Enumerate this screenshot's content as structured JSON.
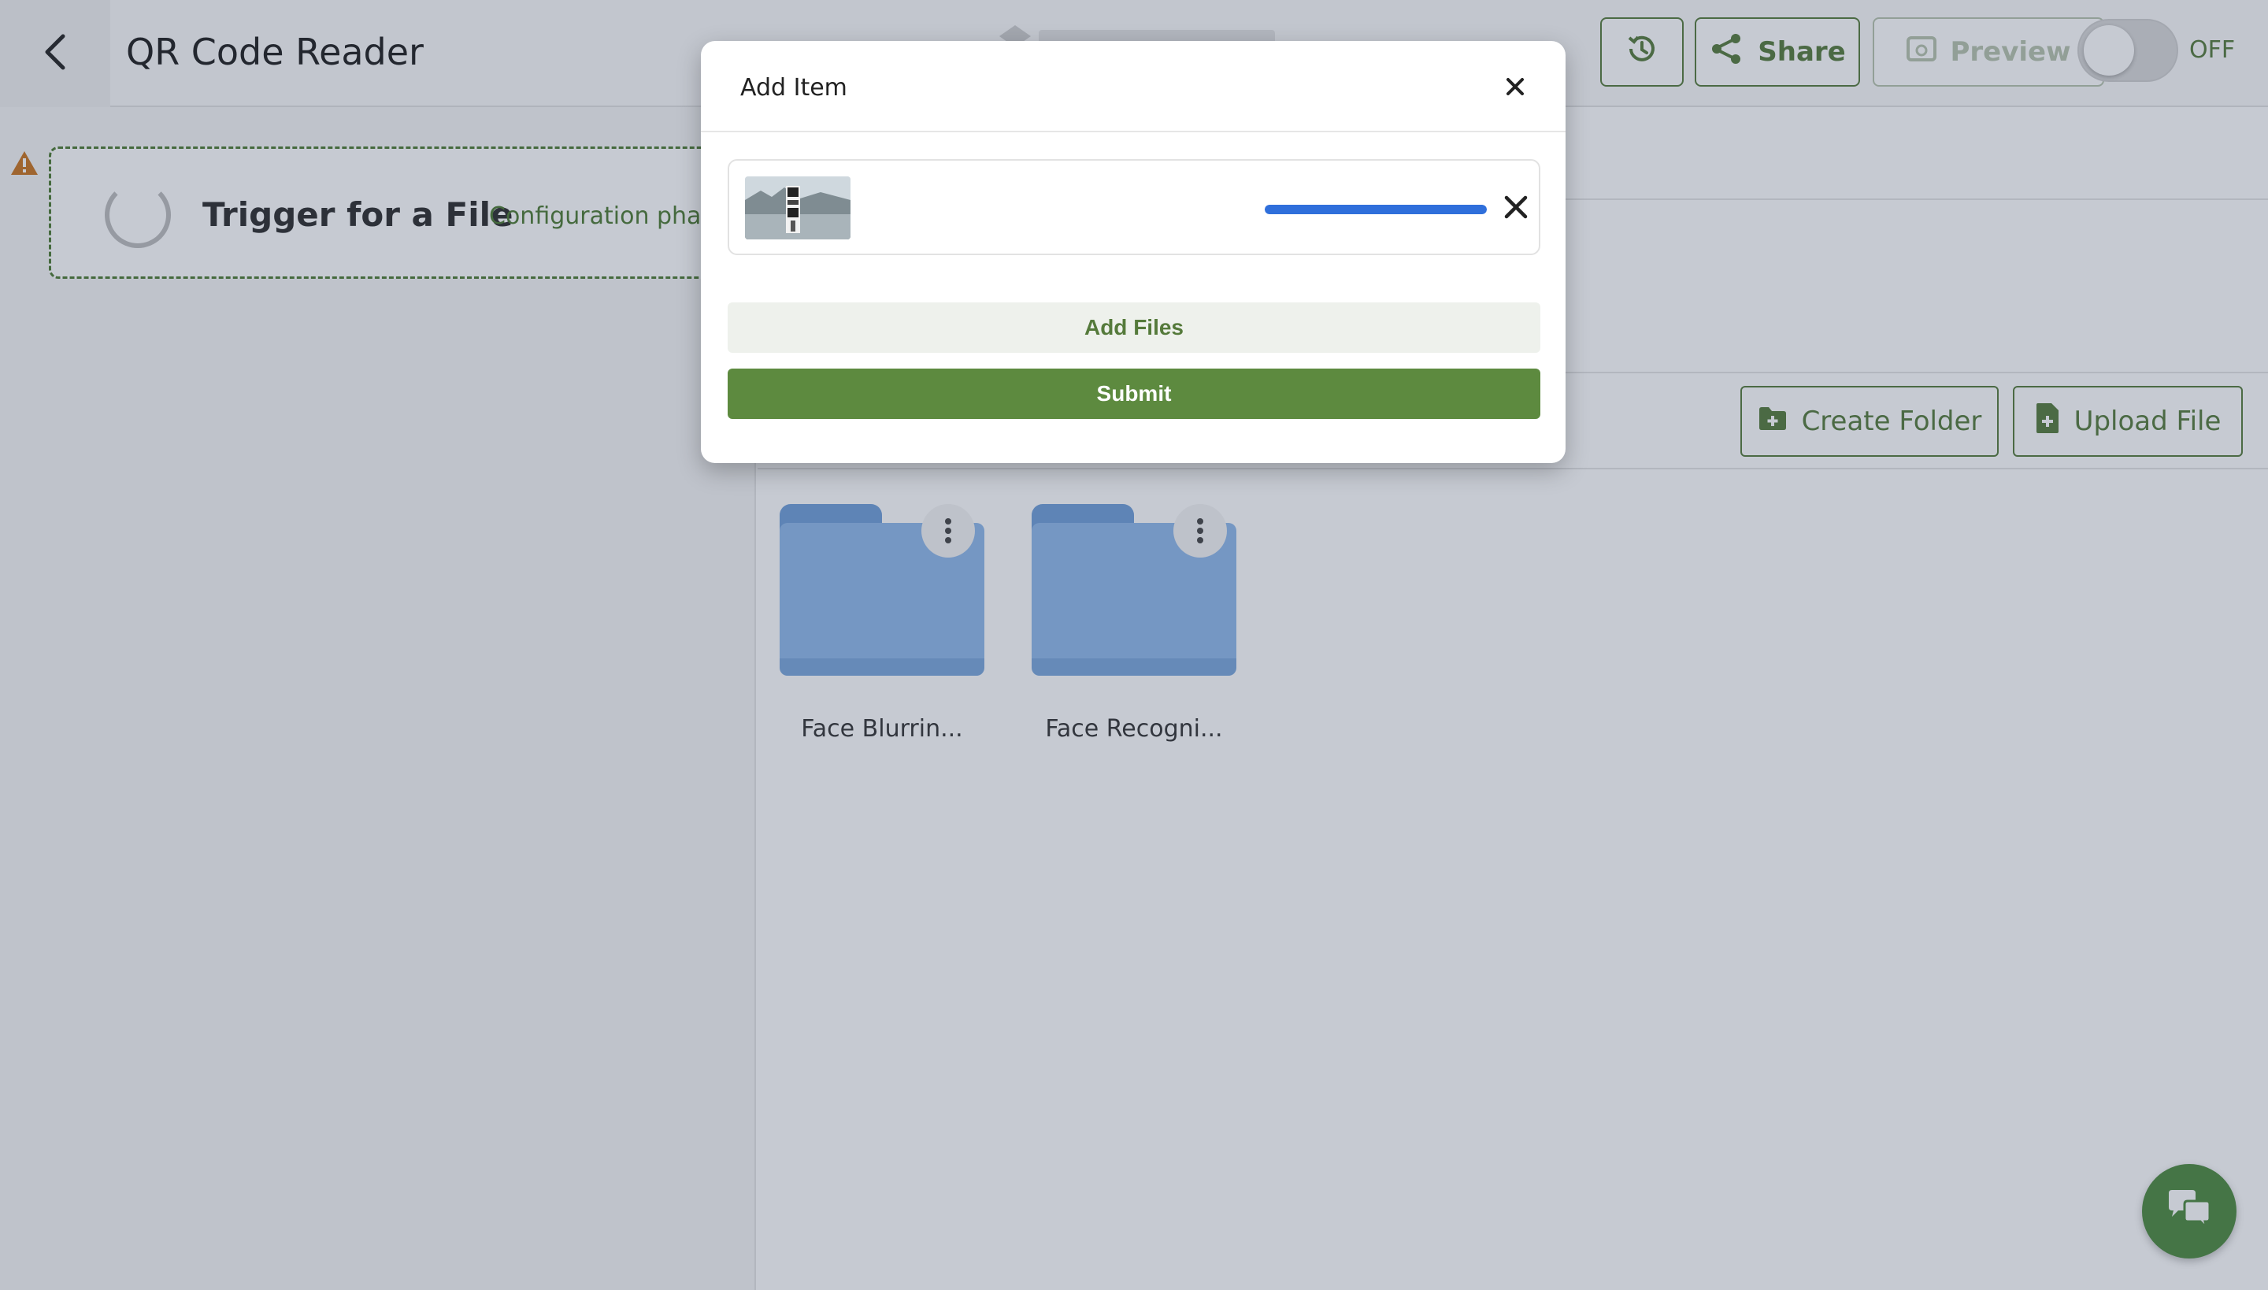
{
  "header": {
    "title": "QR Code Reader",
    "share_label": "Share",
    "preview_label": "Preview",
    "toggle_state": "OFF",
    "icons": [
      "back-arrow-icon",
      "history-icon",
      "share-icon",
      "eye-icon"
    ]
  },
  "trigger": {
    "title": "Trigger for a File",
    "phase": "Configuration phase"
  },
  "actions": {
    "create_folder": "Create Folder",
    "upload_file": "Upload File"
  },
  "folders": [
    {
      "name": "Face Blurrin..."
    },
    {
      "name": "Face Recogni..."
    }
  ],
  "modal": {
    "title": "Add Item",
    "file": {
      "upload_progress": 1.0
    },
    "add_files_label": "Add Files",
    "submit_label": "Submit"
  },
  "colors": {
    "brand_green": "#557a3b",
    "submit_green": "#5d8a3f",
    "progress_blue": "#2f6fdb",
    "folder_blue": "#8fb9ea",
    "warning_orange": "#c9741e"
  }
}
